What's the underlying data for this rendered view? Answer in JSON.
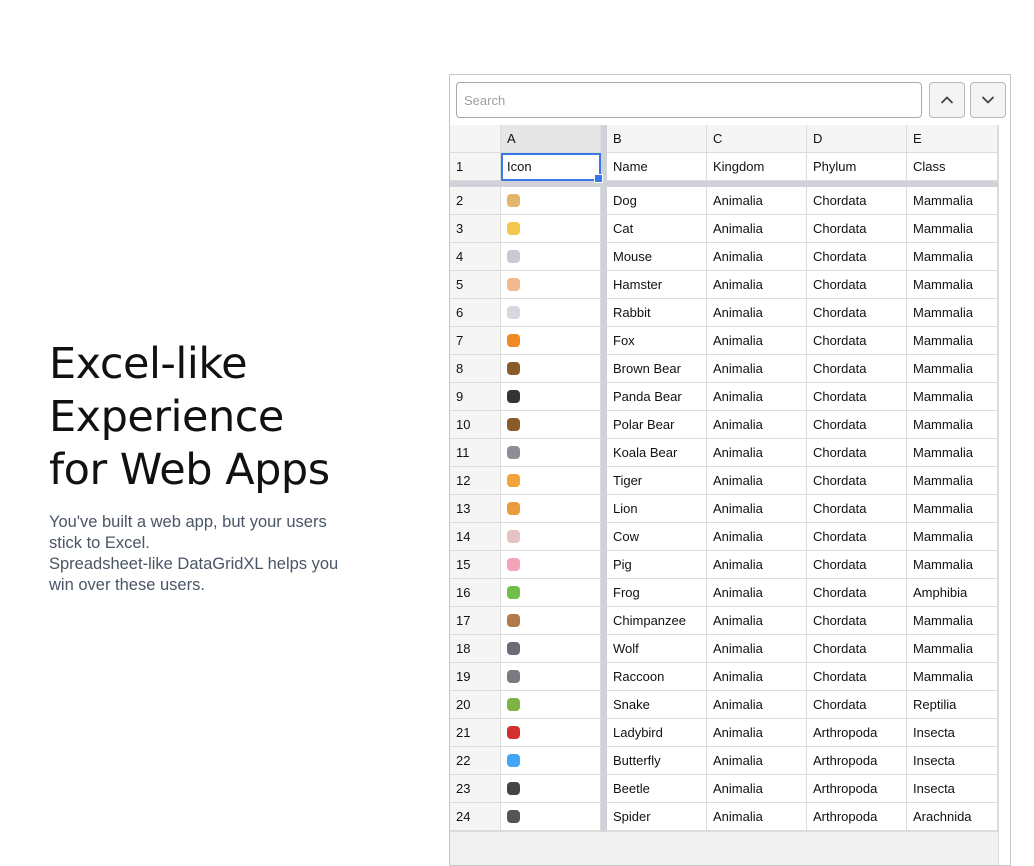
{
  "hero": {
    "title_lines": [
      "Excel-like",
      "Experience",
      "for Web Apps"
    ],
    "description_lines": [
      "You've built a web app, but your users",
      "stick to Excel.",
      "Spreadsheet-like DataGridXL helps you",
      "win over these users."
    ]
  },
  "grid": {
    "search_placeholder": "Search",
    "prev_button": "chevron-up-icon",
    "next_button": "chevron-down-icon",
    "columns": [
      "A",
      "B",
      "C",
      "D",
      "E"
    ],
    "selected_cell": "A1",
    "accent_color": "#3b78e7",
    "header_row": {
      "num": "1",
      "cells": [
        "Icon",
        "Name",
        "Kingdom",
        "Phylum",
        "Class"
      ]
    },
    "rows": [
      {
        "num": "2",
        "icon": "dog-face-icon",
        "icon_color": "#e3b56b",
        "name": "Dog",
        "kingdom": "Animalia",
        "phylum": "Chordata",
        "class": "Mammalia"
      },
      {
        "num": "3",
        "icon": "cat-face-icon",
        "icon_color": "#f2c94c",
        "name": "Cat",
        "kingdom": "Animalia",
        "phylum": "Chordata",
        "class": "Mammalia"
      },
      {
        "num": "4",
        "icon": "mouse-face-icon",
        "icon_color": "#c9c9d3",
        "name": "Mouse",
        "kingdom": "Animalia",
        "phylum": "Chordata",
        "class": "Mammalia"
      },
      {
        "num": "5",
        "icon": "hamster-face-icon",
        "icon_color": "#f0b98f",
        "name": "Hamster",
        "kingdom": "Animalia",
        "phylum": "Chordata",
        "class": "Mammalia"
      },
      {
        "num": "6",
        "icon": "rabbit-face-icon",
        "icon_color": "#d7d7df",
        "name": "Rabbit",
        "kingdom": "Animalia",
        "phylum": "Chordata",
        "class": "Mammalia"
      },
      {
        "num": "7",
        "icon": "fox-face-icon",
        "icon_color": "#f08a24",
        "name": "Fox",
        "kingdom": "Animalia",
        "phylum": "Chordata",
        "class": "Mammalia"
      },
      {
        "num": "8",
        "icon": "bear-face-icon",
        "icon_color": "#8b5a2b",
        "name": "Brown Bear",
        "kingdom": "Animalia",
        "phylum": "Chordata",
        "class": "Mammalia"
      },
      {
        "num": "9",
        "icon": "panda-face-icon",
        "icon_color": "#333333",
        "name": "Panda Bear",
        "kingdom": "Animalia",
        "phylum": "Chordata",
        "class": "Mammalia"
      },
      {
        "num": "10",
        "icon": "bear-face-snowflake-icon",
        "icon_color": "#8b5a2b",
        "name": "Polar Bear",
        "kingdom": "Animalia",
        "phylum": "Chordata",
        "class": "Mammalia"
      },
      {
        "num": "11",
        "icon": "koala-face-icon",
        "icon_color": "#8e8e96",
        "name": "Koala Bear",
        "kingdom": "Animalia",
        "phylum": "Chordata",
        "class": "Mammalia"
      },
      {
        "num": "12",
        "icon": "tiger-face-icon",
        "icon_color": "#f2a33a",
        "name": "Tiger",
        "kingdom": "Animalia",
        "phylum": "Chordata",
        "class": "Mammalia"
      },
      {
        "num": "13",
        "icon": "lion-face-icon",
        "icon_color": "#e89c3c",
        "name": "Lion",
        "kingdom": "Animalia",
        "phylum": "Chordata",
        "class": "Mammalia"
      },
      {
        "num": "14",
        "icon": "cow-face-icon",
        "icon_color": "#e6c3c3",
        "name": "Cow",
        "kingdom": "Animalia",
        "phylum": "Chordata",
        "class": "Mammalia"
      },
      {
        "num": "15",
        "icon": "pig-face-icon",
        "icon_color": "#f3a4b8",
        "name": "Pig",
        "kingdom": "Animalia",
        "phylum": "Chordata",
        "class": "Mammalia"
      },
      {
        "num": "16",
        "icon": "frog-face-icon",
        "icon_color": "#6fbf4a",
        "name": "Frog",
        "kingdom": "Animalia",
        "phylum": "Chordata",
        "class": "Amphibia"
      },
      {
        "num": "17",
        "icon": "monkey-face-icon",
        "icon_color": "#b07a4c",
        "name": "Chimpanzee",
        "kingdom": "Animalia",
        "phylum": "Chordata",
        "class": "Mammalia"
      },
      {
        "num": "18",
        "icon": "wolf-face-icon",
        "icon_color": "#6b6b75",
        "name": "Wolf",
        "kingdom": "Animalia",
        "phylum": "Chordata",
        "class": "Mammalia"
      },
      {
        "num": "19",
        "icon": "raccoon-icon",
        "icon_color": "#7a7a80",
        "name": "Raccoon",
        "kingdom": "Animalia",
        "phylum": "Chordata",
        "class": "Mammalia"
      },
      {
        "num": "20",
        "icon": "snake-icon",
        "icon_color": "#7cb342",
        "name": "Snake",
        "kingdom": "Animalia",
        "phylum": "Chordata",
        "class": "Reptilia"
      },
      {
        "num": "21",
        "icon": "ladybird-icon",
        "icon_color": "#d32f2f",
        "name": "Ladybird",
        "kingdom": "Animalia",
        "phylum": "Arthropoda",
        "class": "Insecta"
      },
      {
        "num": "22",
        "icon": "butterfly-icon",
        "icon_color": "#42a5f5",
        "name": "Butterfly",
        "kingdom": "Animalia",
        "phylum": "Arthropoda",
        "class": "Insecta"
      },
      {
        "num": "23",
        "icon": "beetle-icon",
        "icon_color": "#444444",
        "name": "Beetle",
        "kingdom": "Animalia",
        "phylum": "Arthropoda",
        "class": "Insecta"
      },
      {
        "num": "24",
        "icon": "spider-icon",
        "icon_color": "#555555",
        "name": "Spider",
        "kingdom": "Animalia",
        "phylum": "Arthropoda",
        "class": "Arachnida"
      }
    ]
  }
}
